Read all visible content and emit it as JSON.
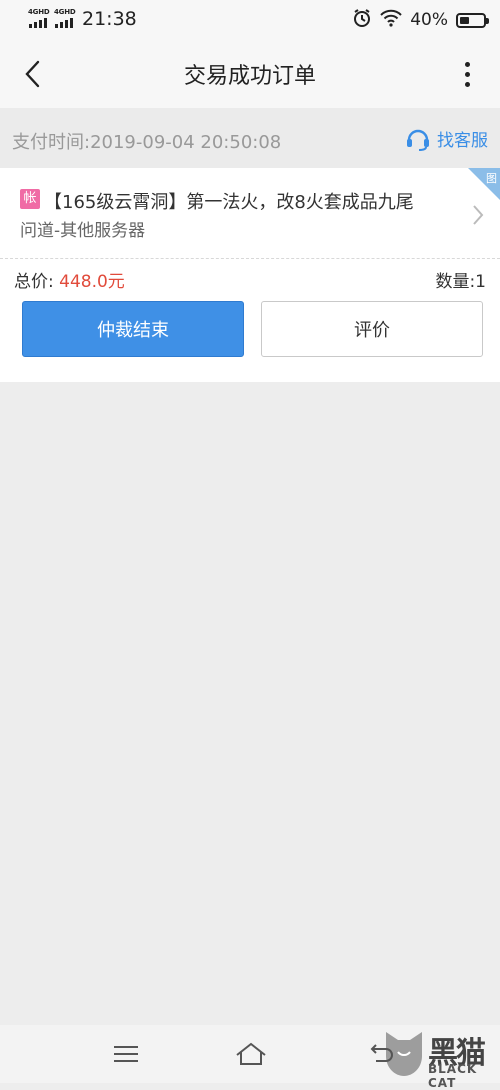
{
  "status_bar": {
    "network1": "4GHD",
    "network2": "4GHD",
    "time": "21:38",
    "battery_pct": "40%",
    "battery_level": 0.4
  },
  "header": {
    "title": "交易成功订单",
    "back_icon": "chevron-left-icon",
    "more_icon": "more-vertical-icon"
  },
  "payment": {
    "time_text": "支付时间:2019-09-04 20:50:08",
    "service_label": "找客服",
    "service_icon": "headset-icon",
    "service_color": "#3a8ee6"
  },
  "product": {
    "tag": "帐",
    "tag_color": "#f06ba5",
    "title_line1": "【165级云霄洞】第一法火，改8火套成品九尾",
    "title_line2": "问道-其他服务器",
    "corner_badge": "图",
    "chevron_icon": "chevron-right-icon"
  },
  "order": {
    "total_label": "总价:",
    "total_amount": "448.0元",
    "quantity_text": "数量:1",
    "amount_color": "#e14b3b"
  },
  "buttons": {
    "primary_label": "仲裁结束",
    "secondary_label": "评价",
    "primary_color": "#3f90e6"
  },
  "nav_bar": {
    "menu_icon": "menu-icon",
    "home_icon": "home-icon",
    "back_icon": "back-icon"
  },
  "watermark": {
    "brand": "黑猫",
    "brand_en": "BLACK CAT"
  }
}
